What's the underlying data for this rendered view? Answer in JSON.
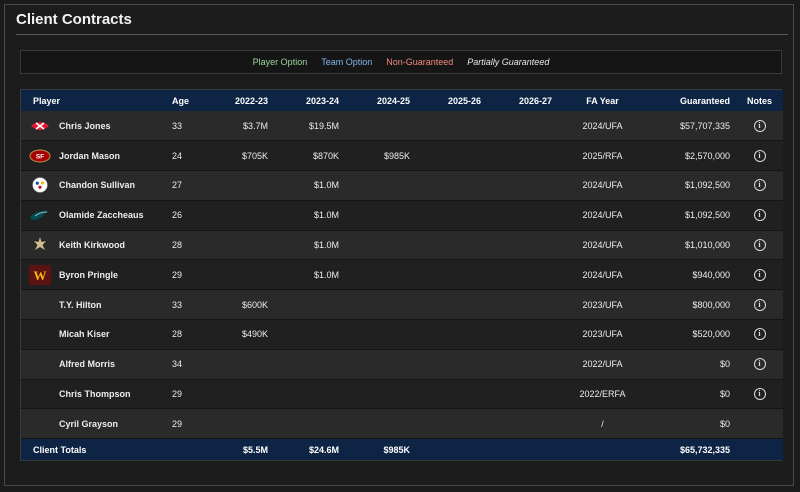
{
  "page": {
    "title": "Client Contracts"
  },
  "legend": {
    "player_option": "Player Option",
    "team_option": "Team Option",
    "non_guaranteed": "Non-Guaranteed",
    "partially_guaranteed": "Partially Guaranteed"
  },
  "colors": {
    "player_option": "#9dd69a",
    "team_option": "#7fb7ea",
    "non_guaranteed": "#f08a7c",
    "header_bg": "#0e2445"
  },
  "table": {
    "headers": {
      "player": "Player",
      "age": "Age",
      "y2022": "2022-23",
      "y2023": "2023-24",
      "y2024": "2024-25",
      "y2025": "2025-26",
      "y2026": "2026-27",
      "fa": "FA Year",
      "guaranteed": "Guaranteed",
      "notes": "Notes"
    },
    "rows": [
      {
        "team_icon": "chiefs-logo-icon",
        "name": "Chris Jones",
        "age": "33",
        "y2022": "$3.7M",
        "y2023": "$19.5M",
        "y2024": "",
        "y2025": "",
        "y2026": "",
        "fa": "2024/UFA",
        "guaranteed": "$57,707,335",
        "notes_icon": "info-icon"
      },
      {
        "team_icon": "49ers-logo-icon",
        "name": "Jordan Mason",
        "age": "24",
        "y2022": "$705K",
        "y2023": "$870K",
        "y2024": "$985K",
        "y2025": "",
        "y2026": "",
        "fa": "2025/RFA",
        "guaranteed": "$2,570,000",
        "notes_icon": "info-icon"
      },
      {
        "team_icon": "steelers-logo-icon",
        "name": "Chandon Sullivan",
        "age": "27",
        "y2022": "",
        "y2023": "$1.0M",
        "y2024": "",
        "y2025": "",
        "y2026": "",
        "fa": "2024/UFA",
        "guaranteed": "$1,092,500",
        "notes_icon": "info-icon"
      },
      {
        "team_icon": "eagles-logo-icon",
        "name": "Olamide Zaccheaus",
        "age": "26",
        "y2022": "",
        "y2023": "$1.0M",
        "y2024": "",
        "y2025": "",
        "y2026": "",
        "fa": "2024/UFA",
        "guaranteed": "$1,092,500",
        "notes_icon": "info-icon"
      },
      {
        "team_icon": "saints-logo-icon",
        "name": "Keith Kirkwood",
        "age": "28",
        "y2022": "",
        "y2023": "$1.0M",
        "y2024": "",
        "y2025": "",
        "y2026": "",
        "fa": "2024/UFA",
        "guaranteed": "$1,010,000",
        "notes_icon": "info-icon"
      },
      {
        "team_icon": "commanders-logo-icon",
        "name": "Byron Pringle",
        "age": "29",
        "y2022": "",
        "y2023": "$1.0M",
        "y2024": "",
        "y2025": "",
        "y2026": "",
        "fa": "2024/UFA",
        "guaranteed": "$940,000",
        "notes_icon": "info-icon"
      },
      {
        "team_icon": "",
        "name": "T.Y. Hilton",
        "age": "33",
        "y2022": "$600K",
        "y2023": "",
        "y2024": "",
        "y2025": "",
        "y2026": "",
        "fa": "2023/UFA",
        "guaranteed": "$800,000",
        "notes_icon": "info-icon"
      },
      {
        "team_icon": "",
        "name": "Micah Kiser",
        "age": "28",
        "y2022": "$490K",
        "y2023": "",
        "y2024": "",
        "y2025": "",
        "y2026": "",
        "fa": "2023/UFA",
        "guaranteed": "$520,000",
        "notes_icon": "info-icon"
      },
      {
        "team_icon": "",
        "name": "Alfred Morris",
        "age": "34",
        "y2022": "",
        "y2023": "",
        "y2024": "",
        "y2025": "",
        "y2026": "",
        "fa": "2022/UFA",
        "guaranteed": "$0",
        "notes_icon": "info-icon"
      },
      {
        "team_icon": "",
        "name": "Chris Thompson",
        "age": "29",
        "y2022": "",
        "y2023": "",
        "y2024": "",
        "y2025": "",
        "y2026": "",
        "fa": "2022/ERFA",
        "guaranteed": "$0",
        "notes_icon": "info-icon"
      },
      {
        "team_icon": "",
        "name": "Cyril Grayson",
        "age": "29",
        "y2022": "",
        "y2023": "",
        "y2024": "",
        "y2025": "",
        "y2026": "",
        "fa": "/",
        "guaranteed": "$0",
        "notes_icon": ""
      }
    ],
    "totals": {
      "label": "Client Totals",
      "y2022": "$5.5M",
      "y2023": "$24.6M",
      "y2024": "$985K",
      "y2025": "",
      "y2026": "",
      "guaranteed": "$65,732,335"
    }
  }
}
